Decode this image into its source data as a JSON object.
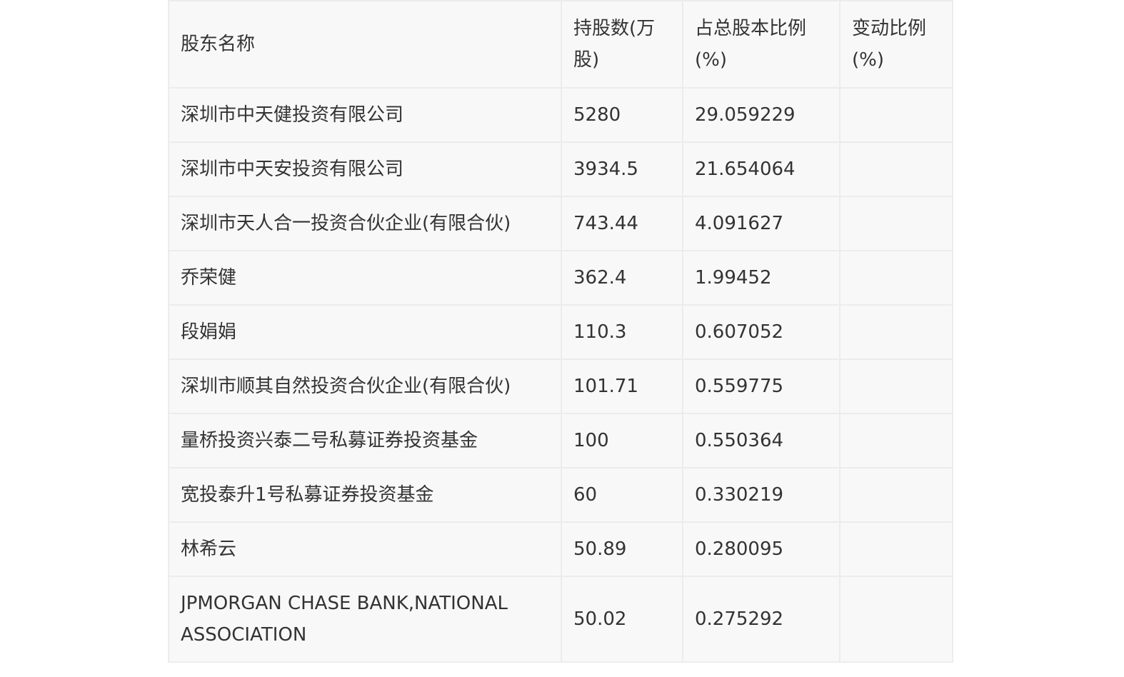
{
  "table": {
    "headers": [
      "股东名称",
      "持股数(万股)",
      "占总股本比例(%)",
      "变动比例(%)"
    ],
    "rows": [
      [
        "深圳市中天健投资有限公司",
        "5280",
        "29.059229",
        ""
      ],
      [
        "深圳市中天安投资有限公司",
        "3934.5",
        "21.654064",
        ""
      ],
      [
        "深圳市天人合一投资合伙企业(有限合伙)",
        "743.44",
        "4.091627",
        ""
      ],
      [
        "乔荣健",
        "362.4",
        "1.99452",
        ""
      ],
      [
        "段娟娟",
        "110.3",
        "0.607052",
        ""
      ],
      [
        "深圳市顺其自然投资合伙企业(有限合伙)",
        "101.71",
        "0.559775",
        ""
      ],
      [
        "量桥投资兴泰二号私募证券投资基金",
        "100",
        "0.550364",
        ""
      ],
      [
        "宽投泰升1号私募证券投资基金",
        "60",
        "0.330219",
        ""
      ],
      [
        "林希云",
        "50.89",
        "0.280095",
        ""
      ],
      [
        "JPMORGAN CHASE BANK,NATIONAL ASSOCIATION",
        "50.02",
        "0.275292",
        ""
      ]
    ]
  }
}
